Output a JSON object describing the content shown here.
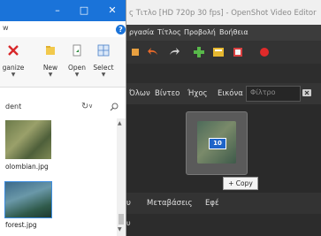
{
  "openshot": {
    "title": "ς Τιτλο [HD 720p 30 fps] - OpenShot Video Editor",
    "menu": [
      "ργασία",
      "Τίτλος",
      "Προβολή",
      "Βοήθεια"
    ],
    "tabs": [
      "Όλων",
      "Βίντεο",
      "Ήχος",
      "Εικόνα"
    ],
    "filter_placeholder": "Φίλτρο",
    "drag_count": "10",
    "copy_tooltip": "+ Copy",
    "bottom_tabs": [
      "υ",
      "Μεταβάσεις",
      "Εφέ"
    ],
    "bottom_text": "υ",
    "toolbar_icons": [
      "undo-icon",
      "redo-icon",
      "add-icon",
      "title-icon",
      "export-icon",
      "record-icon"
    ]
  },
  "explorer": {
    "title_partial": "w",
    "ribbon": [
      {
        "label": "ganize",
        "icon": "delete-icon"
      },
      {
        "label": "New",
        "icon": "new-folder-icon"
      },
      {
        "label": "Open",
        "icon": "open-icon"
      },
      {
        "label": "Select",
        "icon": "select-icon"
      }
    ],
    "address": "dent",
    "files": [
      "olombian.jpg",
      "forest.jpg"
    ]
  }
}
